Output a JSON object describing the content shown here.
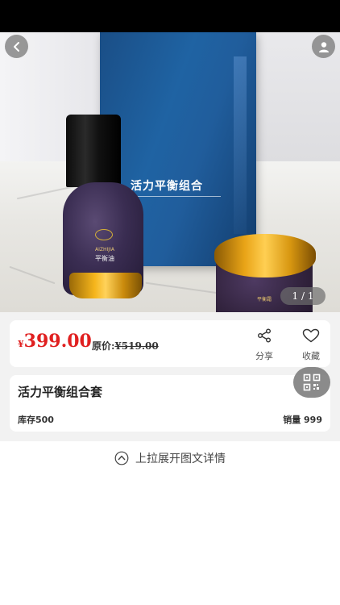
{
  "gallery": {
    "page_indicator": "1 / 1",
    "box_title": "活力平衡组合",
    "bottle_brand": "AIZHIJIA",
    "bottle_name": "平衡油",
    "jar_name": "平衡霜"
  },
  "price": {
    "currency": "¥",
    "amount": "399.00",
    "original_label": "原价:",
    "original_value": "¥519.00",
    "color": "#e02020"
  },
  "actions": {
    "share_label": "分享",
    "favorite_label": "收藏"
  },
  "product": {
    "title": "活力平衡组合套",
    "stock": "库存500",
    "sales": "销量 999"
  },
  "detail": {
    "pull_up_text": "上拉展开图文详情"
  },
  "icons": {
    "back": "chevron-left-icon",
    "user": "user-icon",
    "share": "share-icon",
    "favorite": "heart-outline-icon",
    "qr": "qr-code-icon",
    "pull_up": "chevron-up-circle-icon"
  }
}
